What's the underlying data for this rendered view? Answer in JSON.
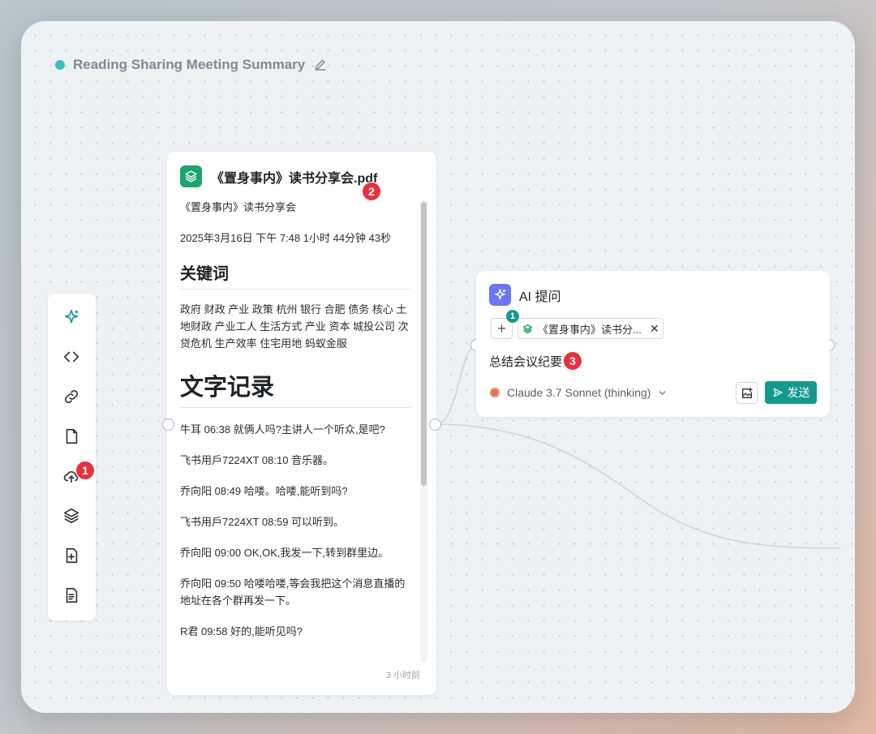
{
  "title": "Reading Sharing Meeting Summary",
  "colors": {
    "accent": "#14998f",
    "badge": "#e8313f",
    "status_dot": "#3fbfb3",
    "doc_icon": "#19a56c",
    "ai_icon": "#6b77f0"
  },
  "toolbar": {
    "items": [
      {
        "icon": "sparkle-icon"
      },
      {
        "icon": "code-icon"
      },
      {
        "icon": "link-icon"
      },
      {
        "icon": "file-icon"
      },
      {
        "icon": "cloud-upload-icon"
      },
      {
        "icon": "layers-icon"
      },
      {
        "icon": "file-plus-icon"
      },
      {
        "icon": "file-text-icon"
      }
    ]
  },
  "badges": {
    "one": "1",
    "two": "2",
    "three": "3"
  },
  "doc": {
    "file_name": "《置身事内》读书分享会.pdf",
    "title_line": "《置身事内》读书分享会",
    "date_line": "2025年3月16日 下午 7:48 1小时 44分钟 43秒",
    "keywords_heading": "关键词",
    "keywords": "政府 财政 产业 政策 杭州 银行 合肥 债务 核心 土地财政 产业工人 生活方式 产业 资本 城投公司 次贷危机 生产效率 住宅用地 蚂蚁金服",
    "transcript_heading": "文字记录",
    "transcript": [
      "牛耳 06:38 就俩人吗?主讲人一个听众,是吧?",
      "飞书用戶7224XT 08:10 音乐器。",
      "乔向阳 08:49 哈喽。哈喽,能听到吗?",
      "飞书用戶7224XT 08:59 可以听到。",
      "乔向阳 09:00 OK,OK,我发一下,转到群里边。",
      "乔向阳 09:50 哈喽哈喽,等会我把这个消息直播的地址在各个群再发一下。",
      "R君 09:58 好的,能听见吗?"
    ],
    "time_ago": "3 小时前"
  },
  "ai": {
    "title": "AI 提问",
    "context_count": "1",
    "chip_label": "《置身事内》读书分...",
    "prompt": "总结会议纪要",
    "model": "Claude 3.7 Sonnet (thinking)",
    "send_label": "发送"
  }
}
